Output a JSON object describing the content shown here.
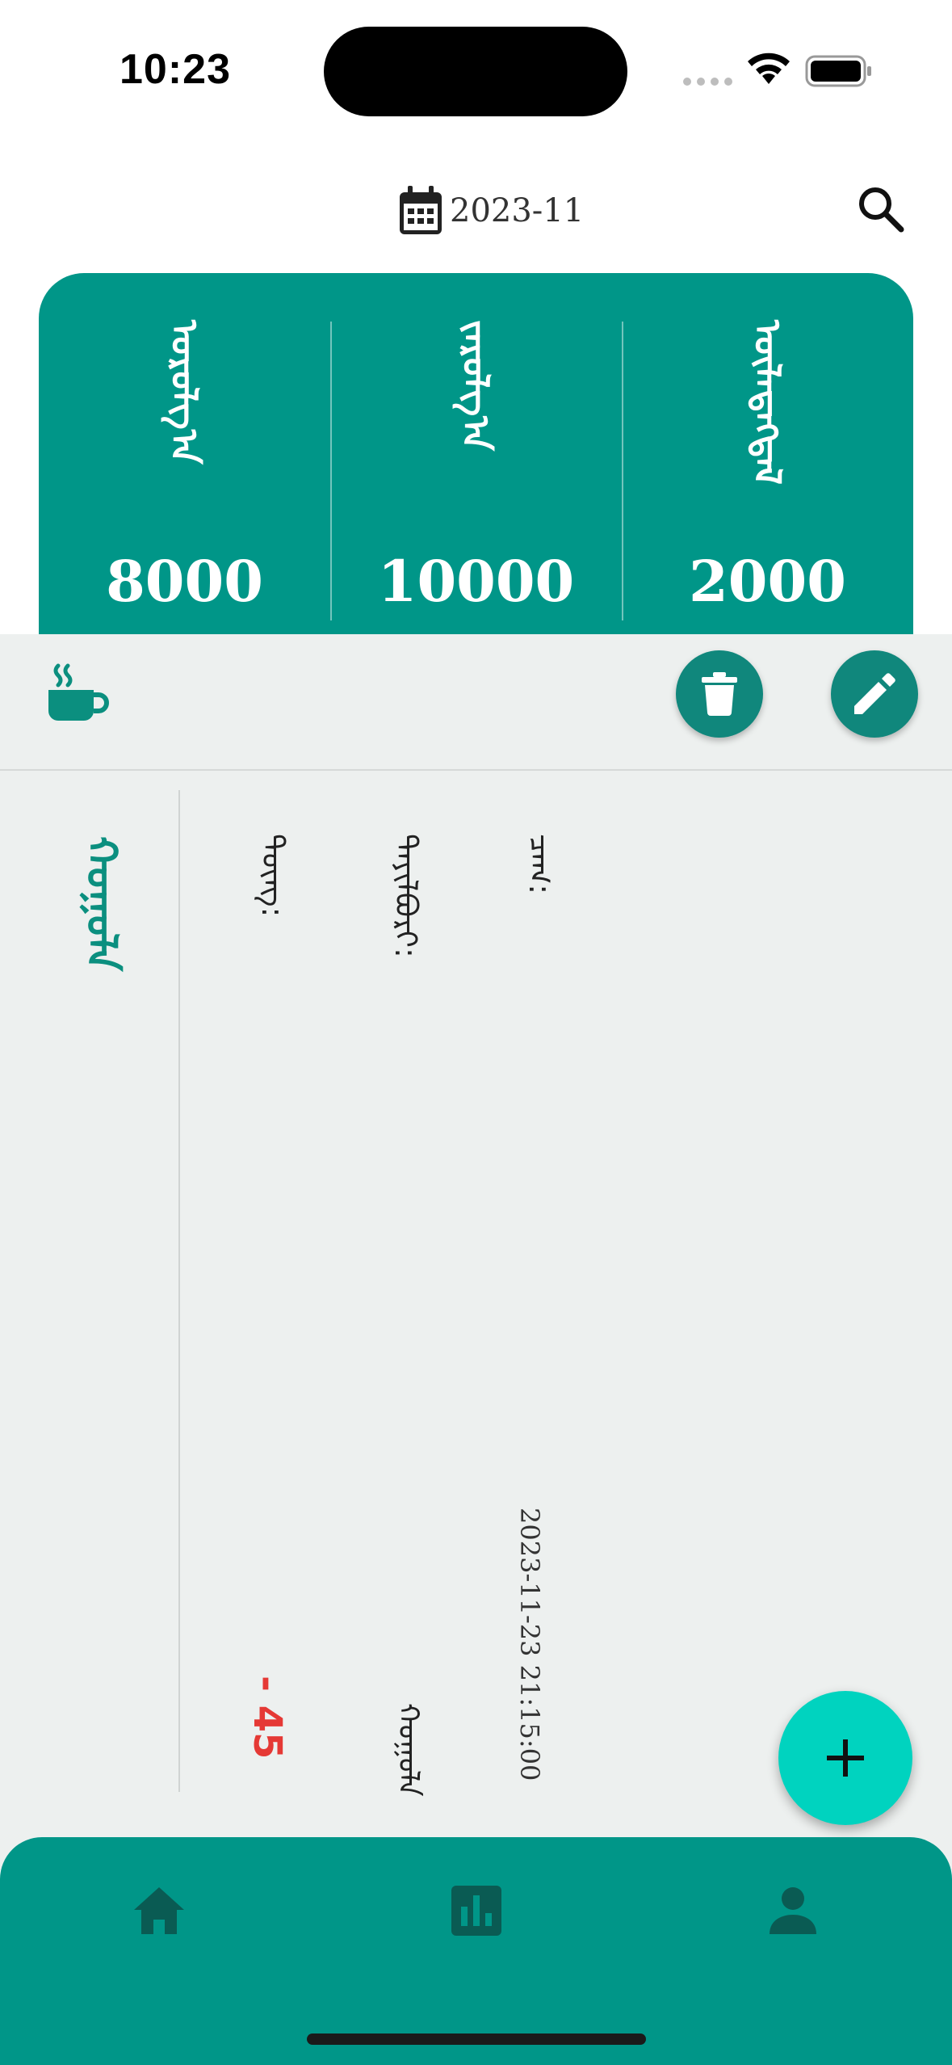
{
  "status_bar": {
    "time": "10:23"
  },
  "header": {
    "date": "2023-11"
  },
  "summary": {
    "columns": [
      {
        "label": "ᠣᠷᠣᠯᠭ᠎ᠠ",
        "value": "8000"
      },
      {
        "label": "ᠵᠠᠷᠤᠯᠭ᠎ᠠ",
        "value": "10000"
      },
      {
        "label": "ᠦᠯᠡᠳᠡᠭᠳᠡᠯ",
        "value": "2000"
      }
    ]
  },
  "record": {
    "category": "ᠬᠣᠭᠣᠯᠠ",
    "amount_label": "ᠳᠦᠩ:",
    "amount": "- 45",
    "note_label": "ᠲᠠᠶᠢᠯᠪᠤᠷᠢ:",
    "note": "ᠬᠣᠭᠣᠯᠠ",
    "time_label": "ᠴᠠᠭ:",
    "datetime": "2023-11-23 21:15:00"
  },
  "colors": {
    "brand": "#009688",
    "fab": "#00d3bf",
    "amount_negative": "#e53935",
    "panel": "#edf0ef"
  },
  "icons": [
    "calendar-icon",
    "search-icon",
    "cup-icon",
    "trash-icon",
    "pencil-icon",
    "plus-icon",
    "home-icon",
    "chart-icon",
    "person-icon"
  ]
}
